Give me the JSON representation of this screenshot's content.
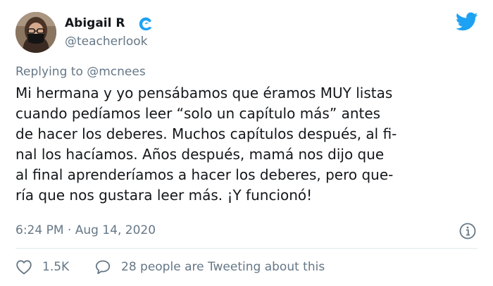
{
  "author": {
    "name": "Abigail R",
    "handle": "@teacherlook"
  },
  "reply_context": {
    "prefix": "Replying to",
    "mention": "@mcnees"
  },
  "tweet": {
    "lines": [
      "Mi hermana y yo pensábamos que éramos MUY listas",
      "cuando pedíamos leer “solo un capítulo más” antes",
      "de hacer los deberes. Muchos capítulos después, al fi-",
      "nal los hacíamos. Años después, mamá nos dijo que",
      "al final aprenderíamos a hacer los deberes, pero que-",
      "ría que nos gustara leer más. ¡Y funcionó!"
    ]
  },
  "meta": {
    "timestamp": "6:24 PM · Aug 14, 2020"
  },
  "actions": {
    "likes": "1.5K",
    "replies": "28 people are Tweeting about this"
  },
  "colors": {
    "twitter_blue": "#1da1f2",
    "secondary_text": "#657786",
    "divider": "#e1e8ed"
  },
  "icons": {
    "logo": "twitter-bird-icon",
    "verified": "wave-badge-icon",
    "info": "info-icon",
    "like": "heart-icon",
    "reply": "speech-bubble-icon"
  }
}
